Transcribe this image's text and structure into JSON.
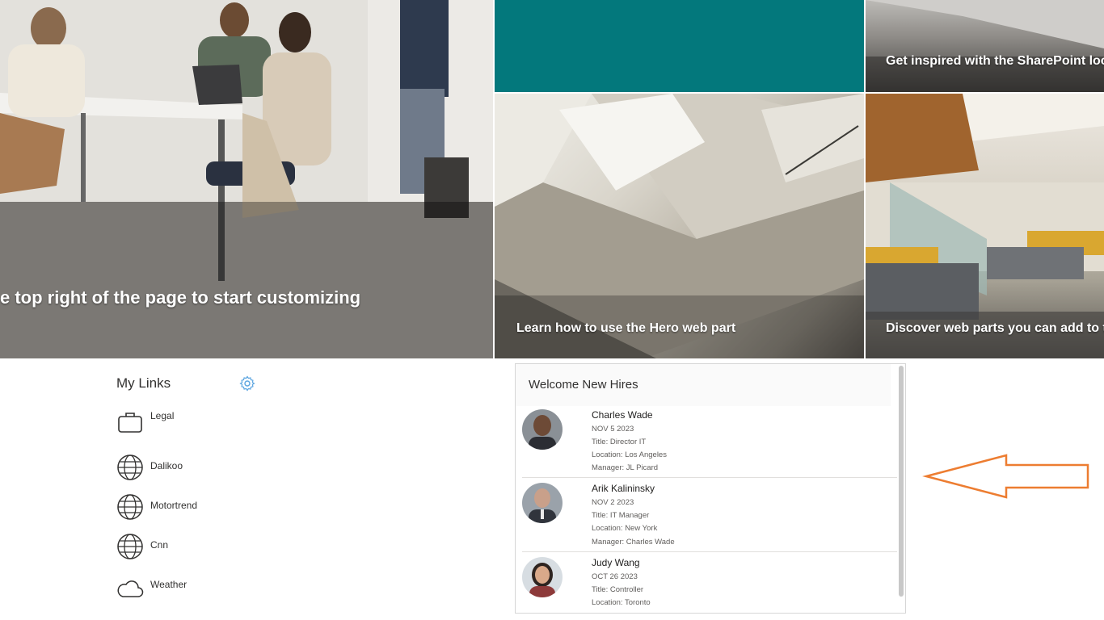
{
  "hero": {
    "tiles": [
      {
        "caption": "e top right of the page to start customizing"
      },
      {
        "caption": ""
      },
      {
        "caption": "Get inspired with the SharePoint loo"
      },
      {
        "caption": "Learn how to use the Hero web part"
      },
      {
        "caption": "Discover web parts you can add to t"
      }
    ],
    "teal_color": "#03787c"
  },
  "my_links": {
    "title": "My Links",
    "settings_icon": "gear-icon",
    "items": [
      {
        "label": "Legal",
        "icon": "briefcase-icon"
      },
      {
        "label": "Dalikoo",
        "icon": "globe-icon"
      },
      {
        "label": "Motortrend",
        "icon": "globe-icon"
      },
      {
        "label": "Cnn",
        "icon": "globe-icon"
      },
      {
        "label": "Weather",
        "icon": "cloud-icon"
      }
    ]
  },
  "new_hires": {
    "title": "Welcome New Hires",
    "people": [
      {
        "name": "Charles Wade",
        "date": "NOV 5 2023",
        "title": "Title: Director IT",
        "location": "Location: Los Angeles",
        "manager": "Manager: JL Picard"
      },
      {
        "name": "Arik Kalininsky",
        "date": "NOV 2 2023",
        "title": "Title: IT Manager",
        "location": "Location: New York",
        "manager": "Manager: Charles Wade"
      },
      {
        "name": "Judy Wang",
        "date": "OCT 26 2023",
        "title": "Title: Controller",
        "location": "Location: Toronto"
      }
    ]
  },
  "annotation": {
    "arrow_color": "#ed7d31"
  }
}
